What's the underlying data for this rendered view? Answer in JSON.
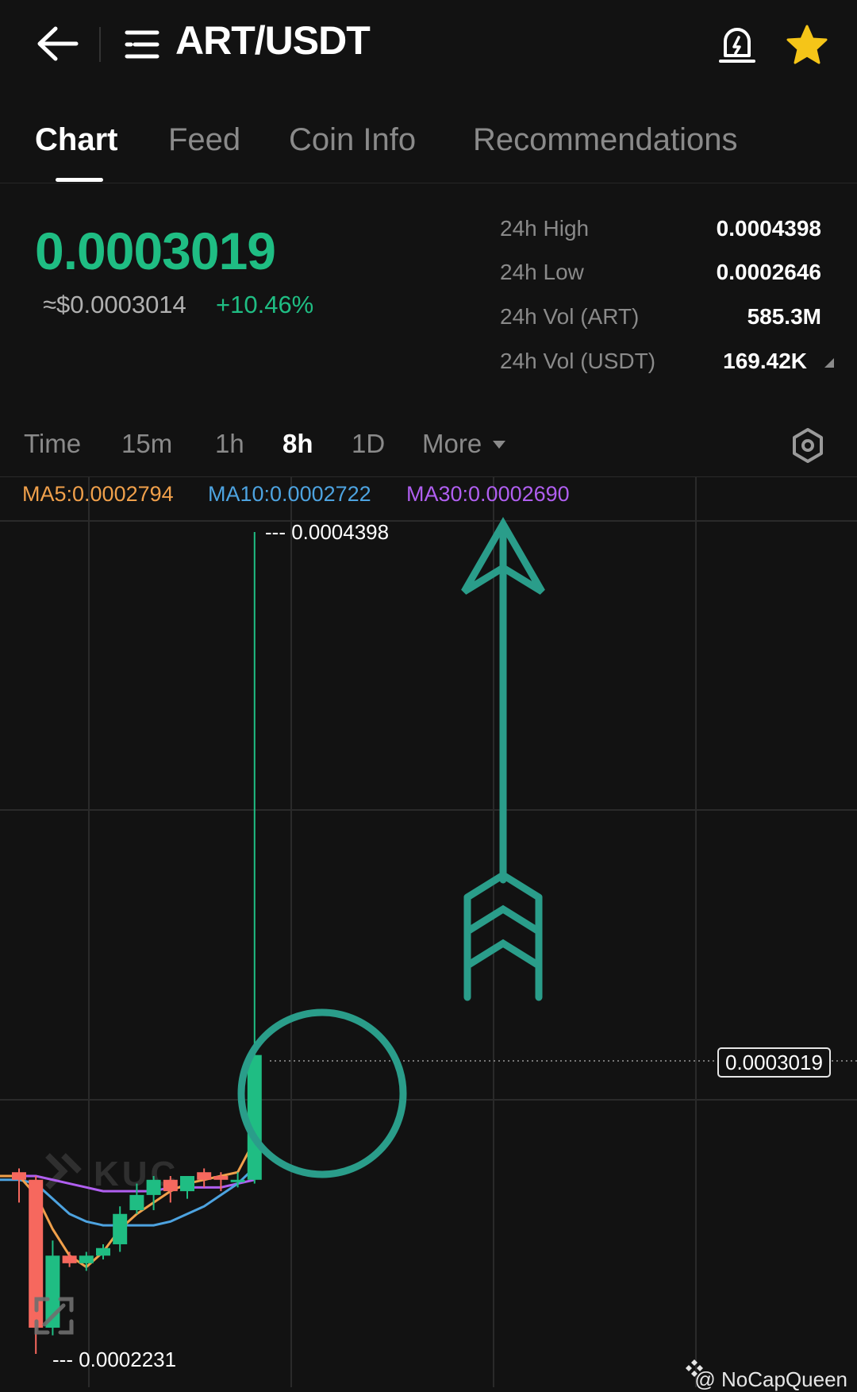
{
  "header": {
    "title": "ART/USDT",
    "icons": [
      "back-arrow-icon",
      "menu-icon",
      "price-alert-bell-icon",
      "favorite-star-icon"
    ],
    "accent_star": "#f5c518"
  },
  "tabs": [
    {
      "label": "Chart",
      "active": true
    },
    {
      "label": "Feed"
    },
    {
      "label": "Coin Info"
    },
    {
      "label": "Recommendations"
    }
  ],
  "ticker": {
    "price": "0.0003019",
    "usd_price": "≈$0.0003014",
    "change": "+10.46%",
    "stats": [
      {
        "label": "24h High",
        "value": "0.0004398"
      },
      {
        "label": "24h Low",
        "value": "0.0002646"
      },
      {
        "label": "24h Vol (ART)",
        "value": "585.3M"
      },
      {
        "label": "24h Vol (USDT)",
        "value": "169.42K"
      }
    ]
  },
  "intervals": [
    {
      "label": "Time"
    },
    {
      "label": "15m"
    },
    {
      "label": "1h"
    },
    {
      "label": "8h",
      "active": true
    },
    {
      "label": "1D"
    },
    {
      "label": "More"
    }
  ],
  "indicators": {
    "ma5": "MA5:0.0002794",
    "ma10": "MA10:0.0002722",
    "ma30": "MA30:0.0002690",
    "colors": {
      "ma5": "#f0a04b",
      "ma10": "#4da3e0",
      "ma30": "#b05ff0"
    }
  },
  "chart_data": {
    "type": "candlestick",
    "high_label": "--- 0.0004398",
    "low_label": "--- 0.0002231",
    "current_price_label": "0.0003019",
    "candles": [
      {
        "o": 0.000271,
        "h": 0.000272,
        "l": 0.000263,
        "c": 0.000269
      },
      {
        "o": 0.000269,
        "h": 0.00027,
        "l": 0.0002231,
        "c": 0.00023
      },
      {
        "o": 0.00023,
        "h": 0.000253,
        "l": 0.000228,
        "c": 0.000249
      },
      {
        "o": 0.000249,
        "h": 0.00025,
        "l": 0.000246,
        "c": 0.000247
      },
      {
        "o": 0.000247,
        "h": 0.00025,
        "l": 0.000245,
        "c": 0.000249
      },
      {
        "o": 0.000249,
        "h": 0.000252,
        "l": 0.000248,
        "c": 0.000251
      },
      {
        "o": 0.000252,
        "h": 0.000262,
        "l": 0.00025,
        "c": 0.00026
      },
      {
        "o": 0.000261,
        "h": 0.000268,
        "l": 0.00026,
        "c": 0.000265
      },
      {
        "o": 0.000265,
        "h": 0.00027,
        "l": 0.000261,
        "c": 0.000269
      },
      {
        "o": 0.000269,
        "h": 0.00027,
        "l": 0.000263,
        "c": 0.000266
      },
      {
        "o": 0.000266,
        "h": 0.00027,
        "l": 0.000264,
        "c": 0.00027
      },
      {
        "o": 0.000271,
        "h": 0.000272,
        "l": 0.000267,
        "c": 0.000269
      },
      {
        "o": 0.00027,
        "h": 0.000271,
        "l": 0.000266,
        "c": 0.000269
      },
      {
        "o": 0.000269,
        "h": 0.000271,
        "l": 0.000267,
        "c": 0.000269
      },
      {
        "o": 0.000269,
        "h": 0.0004398,
        "l": 0.000268,
        "c": 0.0003019
      }
    ],
    "ma5": [
      0.00027,
      0.000265,
      0.000256,
      0.000249,
      0.000246,
      0.00025,
      0.000256,
      0.00026,
      0.000263,
      0.000266,
      0.000268,
      0.000269,
      0.00027,
      0.000271,
      0.0002794
    ],
    "ma10": [
      0.000269,
      0.000268,
      0.000264,
      0.00026,
      0.000258,
      0.000257,
      0.000257,
      0.000257,
      0.000257,
      0.000258,
      0.00026,
      0.000262,
      0.000265,
      0.000268,
      0.0002722
    ],
    "ma30": [
      0.00027,
      0.00027,
      0.000269,
      0.000268,
      0.000267,
      0.000266,
      0.000266,
      0.000266,
      0.000266,
      0.000267,
      0.000267,
      0.000267,
      0.000267,
      0.000268,
      0.000269
    ],
    "up_color": "#1fbd83",
    "down_color": "#f6685e"
  },
  "annotation_color": "#2a9d8a",
  "watermark": "@ NoCapQueen"
}
